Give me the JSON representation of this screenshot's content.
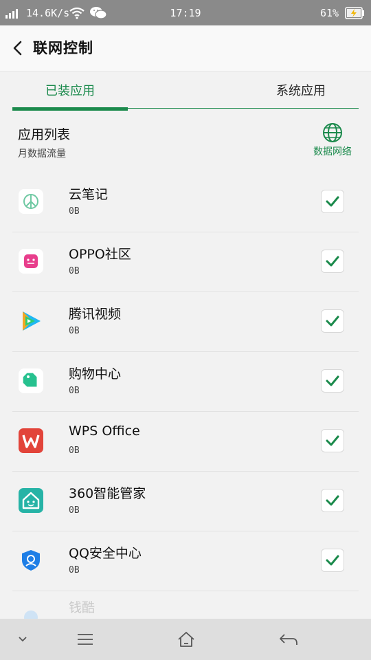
{
  "status_bar": {
    "speed": "14.6K/s",
    "time": "17:19",
    "battery_percent": "61%"
  },
  "header": {
    "title": "联网控制"
  },
  "tabs": [
    {
      "label": "已装应用",
      "selected": true
    },
    {
      "label": "系统应用",
      "selected": false
    }
  ],
  "section": {
    "title": "应用列表",
    "subtitle": "月数据流量",
    "data_network_label": "数据网络"
  },
  "apps": [
    {
      "name": "云笔记",
      "usage": "0B",
      "checked": true,
      "icon": "note-icon"
    },
    {
      "name": "OPPO社区",
      "usage": "0B",
      "checked": true,
      "icon": "community-icon"
    },
    {
      "name": "腾讯视频",
      "usage": "0B",
      "checked": true,
      "icon": "video-play-icon"
    },
    {
      "name": "购物中心",
      "usage": "0B",
      "checked": true,
      "icon": "shopping-tag-icon"
    },
    {
      "name": "WPS Office",
      "usage": "0B",
      "checked": true,
      "icon": "wps-icon"
    },
    {
      "name": "360智能管家",
      "usage": "0B",
      "checked": true,
      "icon": "smart-home-icon"
    },
    {
      "name": "QQ安全中心",
      "usage": "0B",
      "checked": true,
      "icon": "shield-icon"
    },
    {
      "name": "钱酷",
      "usage": "",
      "checked": true,
      "icon": "app-icon"
    }
  ],
  "colors": {
    "accent": "#1b8a4c",
    "status_bar": "#8a8a8a",
    "nav_bar": "#dedede"
  }
}
